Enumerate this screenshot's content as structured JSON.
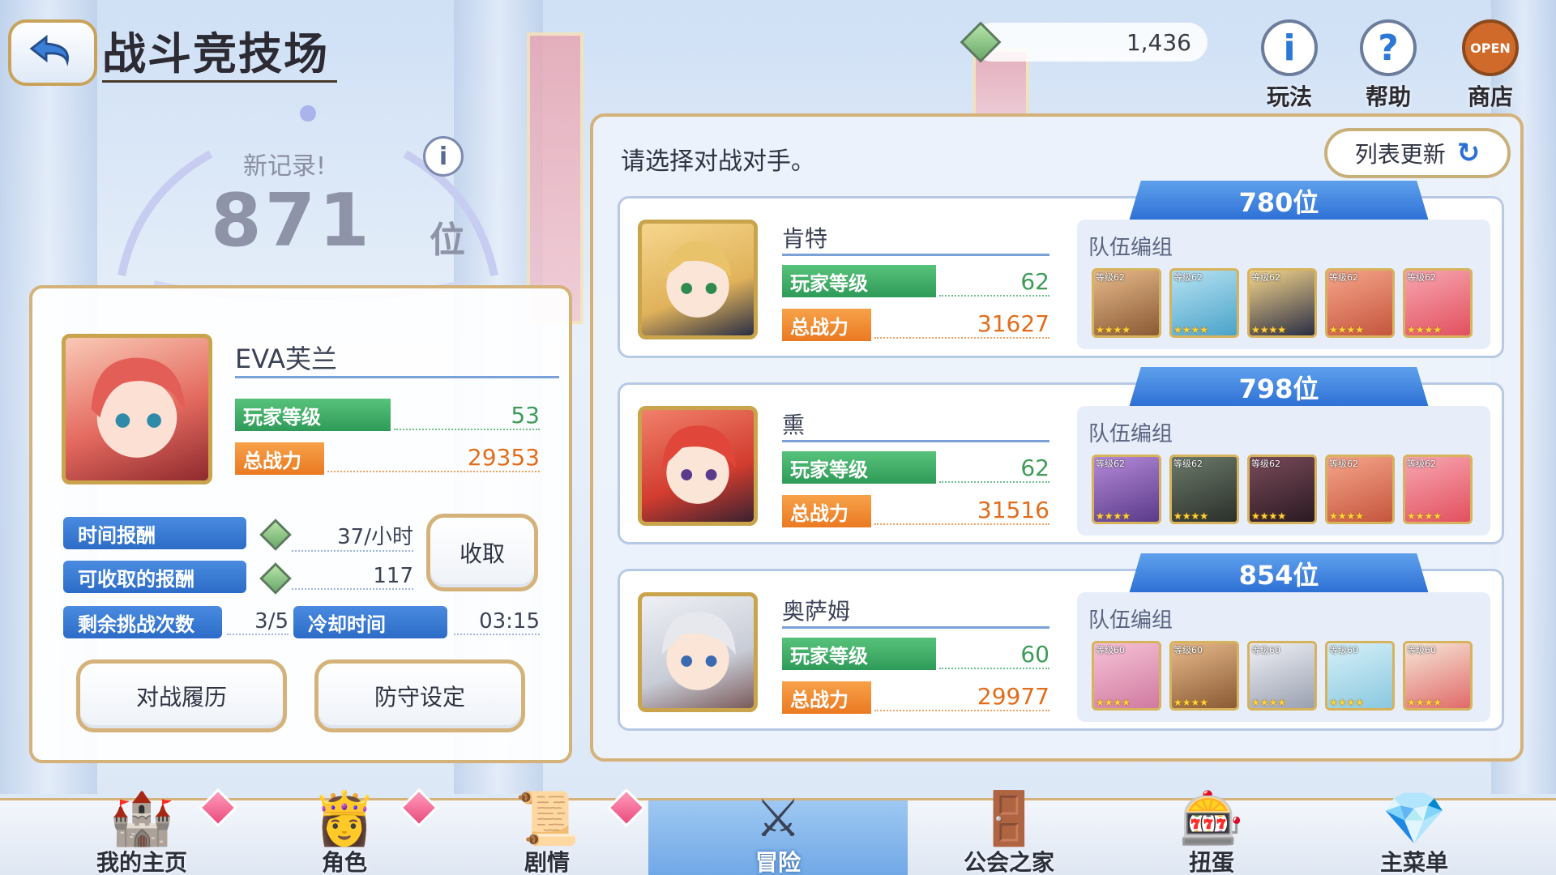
{
  "header": {
    "title": "战斗竞技场",
    "currency_value": "1,436",
    "top_icons": [
      {
        "label": "玩法",
        "icon": "info-icon",
        "glyph": "i"
      },
      {
        "label": "帮助",
        "icon": "help-icon",
        "glyph": "?"
      },
      {
        "label": "商店",
        "icon": "shop-icon",
        "glyph": "OPEN"
      }
    ]
  },
  "record": {
    "new_record_label": "新记录!",
    "rank_number": "871",
    "rank_unit": "位"
  },
  "player": {
    "name": "EVA芙兰",
    "level_label": "玩家等级",
    "level": "53",
    "power_label": "总战力",
    "power": "29353"
  },
  "rewards": {
    "time_reward_label": "时间报酬",
    "time_reward_value": "37/小时",
    "collectable_label": "可收取的报酬",
    "collectable_value": "117",
    "collect_button": "收取",
    "remaining_label": "剩余挑战次数",
    "remaining_value": "3/5",
    "cooldown_label": "冷却时间",
    "cooldown_value": "03:15"
  },
  "buttons": {
    "history": "对战履历",
    "defense": "防守设定"
  },
  "opponents_panel": {
    "prompt": "请选择对战对手。",
    "refresh_button": "列表更新",
    "team_label": "队伍编组",
    "level_label": "玩家等级",
    "power_label": "总战力"
  },
  "opponents": [
    {
      "rank": "780位",
      "name": "肯特",
      "level": "62",
      "power": "31627",
      "units": [
        {
          "lv": "等级62"
        },
        {
          "lv": "等级62"
        },
        {
          "lv": "等级62"
        },
        {
          "lv": "等级62"
        },
        {
          "lv": "等级62"
        }
      ]
    },
    {
      "rank": "798位",
      "name": "熏",
      "level": "62",
      "power": "31516",
      "units": [
        {
          "lv": "等级62"
        },
        {
          "lv": "等级62"
        },
        {
          "lv": "等级62"
        },
        {
          "lv": "等级62"
        },
        {
          "lv": "等级62"
        }
      ]
    },
    {
      "rank": "854位",
      "name": "奥萨姆",
      "level": "60",
      "power": "29977",
      "units": [
        {
          "lv": "等级60"
        },
        {
          "lv": "等级60"
        },
        {
          "lv": "等级60"
        },
        {
          "lv": "等级60"
        },
        {
          "lv": "等级60"
        }
      ]
    }
  ],
  "nav": [
    {
      "label": "我的主页",
      "icon": "castle-icon",
      "glyph": "🏰"
    },
    {
      "label": "角色",
      "icon": "character-icon",
      "glyph": "👸"
    },
    {
      "label": "剧情",
      "icon": "scroll-icon",
      "glyph": "📜"
    },
    {
      "label": "冒险",
      "icon": "swords-icon",
      "glyph": "⚔"
    },
    {
      "label": "公会之家",
      "icon": "guild-door-icon",
      "glyph": "🚪"
    },
    {
      "label": "扭蛋",
      "icon": "gacha-icon",
      "glyph": "🎰"
    },
    {
      "label": "主菜单",
      "icon": "crystal-icon",
      "glyph": "💎"
    }
  ],
  "colors": {
    "accent_gold": "#d4b27a",
    "level_green": "#2e9b58",
    "power_orange": "#ea7a22",
    "rank_blue": "#2c6fd4"
  }
}
